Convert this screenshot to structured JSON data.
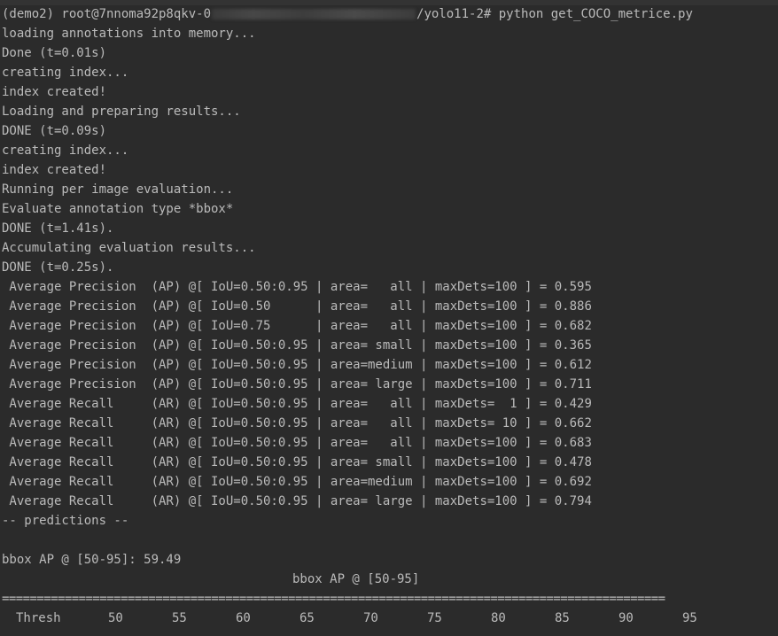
{
  "terminal": {
    "prompt": {
      "prefix": "(demo2) root@7nnoma92p8qkv-0",
      "suffix": "/yolo11-2# python get_COCO_metrice.py"
    },
    "output_lines": [
      "loading annotations into memory...",
      "Done (t=0.01s)",
      "creating index...",
      "index created!",
      "Loading and preparing results...",
      "DONE (t=0.09s)",
      "creating index...",
      "index created!",
      "Running per image evaluation...",
      "Evaluate annotation type *bbox*",
      "DONE (t=1.41s).",
      "Accumulating evaluation results...",
      "DONE (t=0.25s).",
      " Average Precision  (AP) @[ IoU=0.50:0.95 | area=   all | maxDets=100 ] = 0.595",
      " Average Precision  (AP) @[ IoU=0.50      | area=   all | maxDets=100 ] = 0.886",
      " Average Precision  (AP) @[ IoU=0.75      | area=   all | maxDets=100 ] = 0.682",
      " Average Precision  (AP) @[ IoU=0.50:0.95 | area= small | maxDets=100 ] = 0.365",
      " Average Precision  (AP) @[ IoU=0.50:0.95 | area=medium | maxDets=100 ] = 0.612",
      " Average Precision  (AP) @[ IoU=0.50:0.95 | area= large | maxDets=100 ] = 0.711",
      " Average Recall     (AR) @[ IoU=0.50:0.95 | area=   all | maxDets=  1 ] = 0.429",
      " Average Recall     (AR) @[ IoU=0.50:0.95 | area=   all | maxDets= 10 ] = 0.662",
      " Average Recall     (AR) @[ IoU=0.50:0.95 | area=   all | maxDets=100 ] = 0.683",
      " Average Recall     (AR) @[ IoU=0.50:0.95 | area= small | maxDets=100 ] = 0.478",
      " Average Recall     (AR) @[ IoU=0.50:0.95 | area=medium | maxDets=100 ] = 0.692",
      " Average Recall     (AR) @[ IoU=0.50:0.95 | area= large | maxDets=100 ] = 0.794",
      "-- predictions --",
      "",
      "bbox AP @ [50-95]: 59.49"
    ],
    "table": {
      "title": "bbox AP @ [50-95]",
      "separator": "===============================================================================================",
      "header_label": "Thresh",
      "thresholds": [
        "50",
        "55",
        "60",
        "65",
        "70",
        "75",
        "80",
        "85",
        "90",
        "95"
      ]
    },
    "colors": {
      "background": "#2b2b2b",
      "foreground": "#bbbbbb"
    }
  }
}
